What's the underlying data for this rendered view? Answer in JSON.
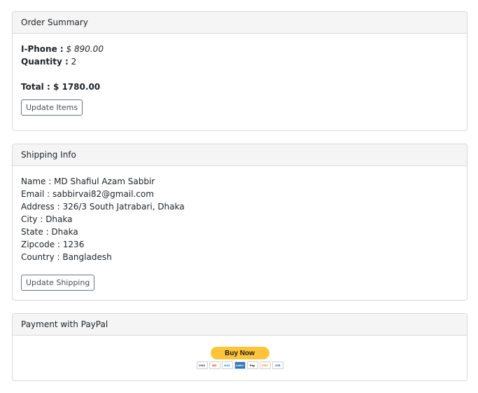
{
  "order_summary": {
    "header": "Order Summary",
    "product_label": "I-Phone :",
    "product_price": "$ 890.00",
    "quantity_label": "Quantity :",
    "quantity_value": "2",
    "total_label": "Total :",
    "total_value": "$ 1780.00",
    "update_button": "Update Items"
  },
  "shipping": {
    "header": "Shipping Info",
    "name": "Name : MD Shafiul Azam Sabbir",
    "email": "Email : sabbirvai82@gmail.com",
    "address": "Address : 326/3 South Jatrabari, Dhaka",
    "city": "City : Dhaka",
    "state": "State : Dhaka",
    "zipcode": "Zipcode : 1236",
    "country": "Country : Bangladesh",
    "update_button": "Update Shipping"
  },
  "payment": {
    "header": "Payment with PayPal",
    "paypal_button": "Buy Now",
    "card_logos": [
      {
        "name": "visa-icon",
        "text": "VISA",
        "bg": "#ffffff",
        "fg": "#1a1f71"
      },
      {
        "name": "mastercard-icon",
        "text": "MC",
        "bg": "#ffffff",
        "fg": "#eb001b"
      },
      {
        "name": "maestro-icon",
        "text": "MAE",
        "bg": "#ffffff",
        "fg": "#0099df"
      },
      {
        "name": "amex-icon",
        "text": "AMEX",
        "bg": "#2e77bc",
        "fg": "#ffffff"
      },
      {
        "name": "applepay-icon",
        "text": "Pay",
        "bg": "#ffffff",
        "fg": "#000000"
      },
      {
        "name": "discover-icon",
        "text": "DISC",
        "bg": "#ffffff",
        "fg": "#f58220"
      },
      {
        "name": "jcb-icon",
        "text": "JCB",
        "bg": "#ffffff",
        "fg": "#0b4ea2"
      }
    ]
  },
  "colors": {
    "paypal_yellow": "#ffc439",
    "header_bg": "#f5f5f5",
    "border": "#d9d9d9"
  }
}
